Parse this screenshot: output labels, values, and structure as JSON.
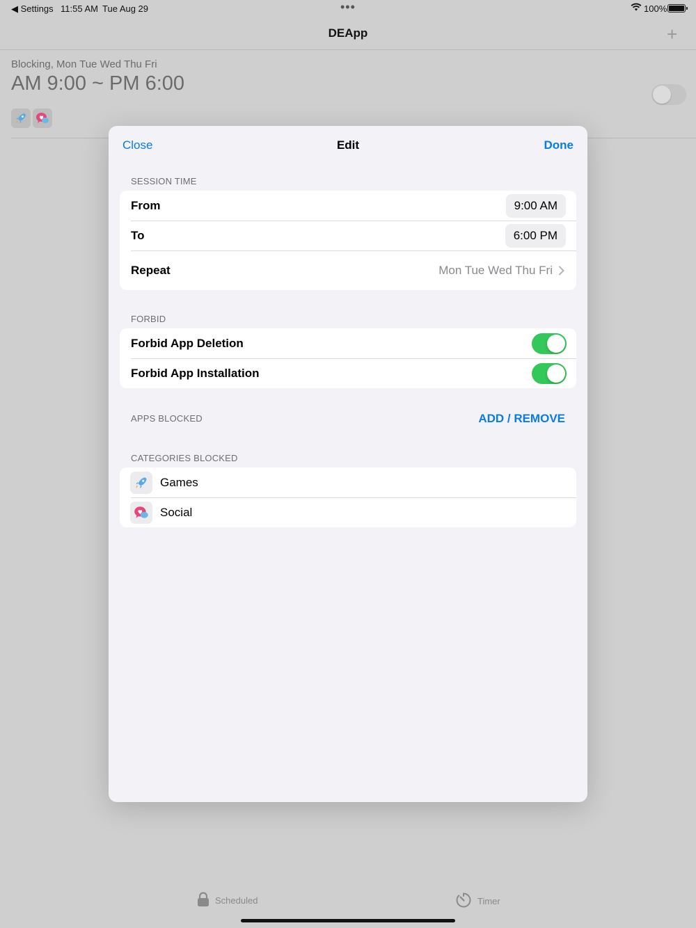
{
  "status_bar": {
    "back_label": "◀ Settings",
    "time": "11:55 AM",
    "date": "Tue Aug 29",
    "dots": "•••",
    "battery_percent": "100%"
  },
  "nav": {
    "title": "DEApp",
    "add_label": "+"
  },
  "schedule": {
    "subtitle": "Blocking, Mon Tue Wed Thu Fri",
    "time_range": "AM 9:00 ~ PM 6:00",
    "enabled": false
  },
  "tabs": [
    {
      "label": "Scheduled",
      "icon": "lock-icon"
    },
    {
      "label": "Timer",
      "icon": "timer-icon"
    }
  ],
  "modal": {
    "close_label": "Close",
    "title": "Edit",
    "done_label": "Done",
    "session_time": {
      "header": "SESSION TIME",
      "from_label": "From",
      "from_value": "9:00 AM",
      "to_label": "To",
      "to_value": "6:00 PM",
      "repeat_label": "Repeat",
      "repeat_value": "Mon Tue Wed Thu Fri"
    },
    "forbid": {
      "header": "FORBID",
      "deletion_label": "Forbid App Deletion",
      "deletion_on": true,
      "installation_label": "Forbid App Installation",
      "installation_on": true
    },
    "apps_blocked": {
      "header": "APPS BLOCKED",
      "action_label": "ADD / REMOVE"
    },
    "categories_blocked": {
      "header": "CATEGORIES BLOCKED",
      "items": [
        {
          "label": "Games",
          "icon": "rocket-icon"
        },
        {
          "label": "Social",
          "icon": "chat-heart-icon"
        }
      ]
    }
  },
  "colors": {
    "accent": "#0a7bea",
    "toggle_on": "#34c759",
    "secondary_text": "#6d6d72"
  }
}
